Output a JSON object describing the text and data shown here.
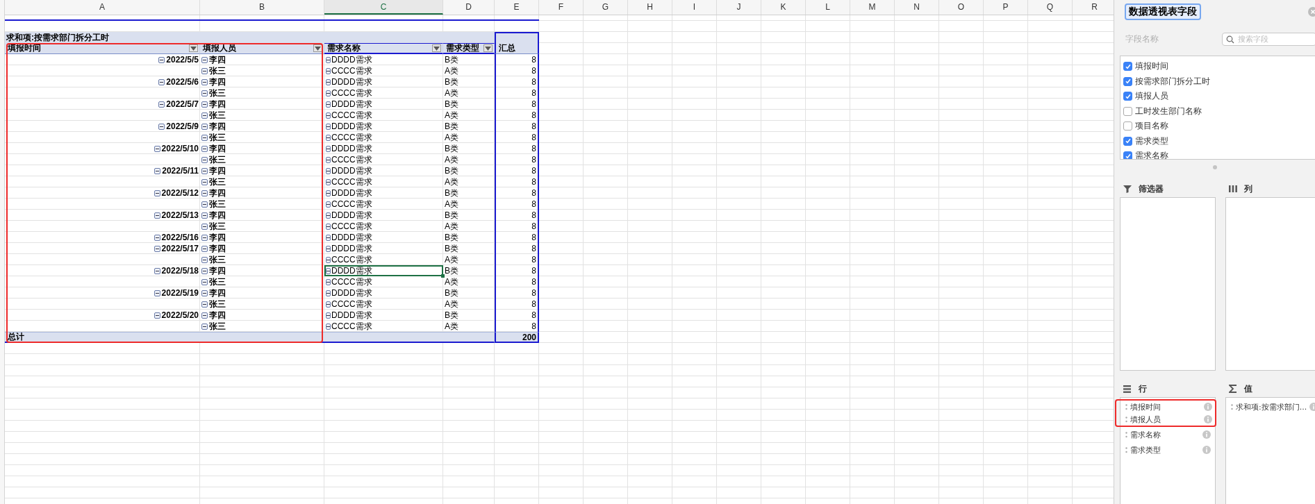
{
  "columns": [
    {
      "label": "A",
      "selected": false
    },
    {
      "label": "B",
      "selected": false
    },
    {
      "label": "C",
      "selected": true
    },
    {
      "label": "D",
      "selected": false
    },
    {
      "label": "E",
      "selected": false
    },
    {
      "label": "F",
      "selected": false
    },
    {
      "label": "G",
      "selected": false
    },
    {
      "label": "H",
      "selected": false
    },
    {
      "label": "I",
      "selected": false
    },
    {
      "label": "J",
      "selected": false
    },
    {
      "label": "K",
      "selected": false
    },
    {
      "label": "L",
      "selected": false
    },
    {
      "label": "M",
      "selected": false
    },
    {
      "label": "N",
      "selected": false
    },
    {
      "label": "O",
      "selected": false
    },
    {
      "label": "P",
      "selected": false
    },
    {
      "label": "Q",
      "selected": false
    },
    {
      "label": "R",
      "selected": false
    }
  ],
  "pivot": {
    "title": "求和项:按需求部门拆分工时",
    "headers": [
      {
        "label": "填报时间",
        "filter": true
      },
      {
        "label": "填报人员",
        "filter": true
      },
      {
        "label": "需求名称",
        "filter": true
      },
      {
        "label": "需求类型",
        "filter": true
      },
      {
        "label": "汇总",
        "filter": false
      }
    ],
    "rows": [
      {
        "date": "2022/5/5",
        "person": "李四",
        "name": "DDDD需求",
        "type": "B类",
        "value": "8",
        "selected": false
      },
      {
        "person": "张三",
        "name": "CCCC需求",
        "type": "A类",
        "value": "8",
        "selected": false
      },
      {
        "date": "2022/5/6",
        "person": "李四",
        "name": "DDDD需求",
        "type": "B类",
        "value": "8",
        "selected": false
      },
      {
        "person": "张三",
        "name": "CCCC需求",
        "type": "A类",
        "value": "8",
        "selected": false
      },
      {
        "date": "2022/5/7",
        "person": "李四",
        "name": "DDDD需求",
        "type": "B类",
        "value": "8",
        "selected": false
      },
      {
        "person": "张三",
        "name": "CCCC需求",
        "type": "A类",
        "value": "8",
        "selected": false
      },
      {
        "date": "2022/5/9",
        "person": "李四",
        "name": "DDDD需求",
        "type": "B类",
        "value": "8",
        "selected": false
      },
      {
        "person": "张三",
        "name": "CCCC需求",
        "type": "A类",
        "value": "8",
        "selected": false
      },
      {
        "date": "2022/5/10",
        "person": "李四",
        "name": "DDDD需求",
        "type": "B类",
        "value": "8",
        "selected": false
      },
      {
        "person": "张三",
        "name": "CCCC需求",
        "type": "A类",
        "value": "8",
        "selected": false
      },
      {
        "date": "2022/5/11",
        "person": "李四",
        "name": "DDDD需求",
        "type": "B类",
        "value": "8",
        "selected": false
      },
      {
        "person": "张三",
        "name": "CCCC需求",
        "type": "A类",
        "value": "8",
        "selected": false
      },
      {
        "date": "2022/5/12",
        "person": "李四",
        "name": "DDDD需求",
        "type": "B类",
        "value": "8",
        "selected": false
      },
      {
        "person": "张三",
        "name": "CCCC需求",
        "type": "A类",
        "value": "8",
        "selected": false
      },
      {
        "date": "2022/5/13",
        "person": "李四",
        "name": "DDDD需求",
        "type": "B类",
        "value": "8",
        "selected": false
      },
      {
        "person": "张三",
        "name": "CCCC需求",
        "type": "A类",
        "value": "8",
        "selected": false
      },
      {
        "date": "2022/5/16",
        "person": "李四",
        "name": "DDDD需求",
        "type": "B类",
        "value": "8",
        "selected": false
      },
      {
        "date": "2022/5/17",
        "person": "李四",
        "name": "DDDD需求",
        "type": "B类",
        "value": "8",
        "selected": false
      },
      {
        "person": "张三",
        "name": "CCCC需求",
        "type": "A类",
        "value": "8",
        "selected": false
      },
      {
        "date": "2022/5/18",
        "person": "李四",
        "name": "DDDD需求",
        "type": "B类",
        "value": "8",
        "selected": true
      },
      {
        "person": "张三",
        "name": "CCCC需求",
        "type": "A类",
        "value": "8",
        "selected": false
      },
      {
        "date": "2022/5/19",
        "person": "李四",
        "name": "DDDD需求",
        "type": "B类",
        "value": "8",
        "selected": false
      },
      {
        "person": "张三",
        "name": "CCCC需求",
        "type": "A类",
        "value": "8",
        "selected": false
      },
      {
        "date": "2022/5/20",
        "person": "李四",
        "name": "DDDD需求",
        "type": "B类",
        "value": "8",
        "selected": false
      },
      {
        "person": "张三",
        "name": "CCCC需求",
        "type": "A类",
        "value": "8",
        "selected": false
      }
    ],
    "total": {
      "label": "总计",
      "value": "200"
    }
  },
  "panel": {
    "title": "数据透视表字段",
    "field_label": "字段名称",
    "search": {
      "placeholder": "搜索字段"
    },
    "fields": [
      {
        "label": "填报时间",
        "checked": true
      },
      {
        "label": "按需求部门拆分工时",
        "checked": true
      },
      {
        "label": "填报人员",
        "checked": true
      },
      {
        "label": "工时发生部门名称",
        "checked": false
      },
      {
        "label": "项目名称",
        "checked": false
      },
      {
        "label": "需求类型",
        "checked": true
      },
      {
        "label": "需求名称",
        "checked": true
      }
    ],
    "areas": [
      {
        "kind": "filter",
        "label": "筛选器"
      },
      {
        "kind": "columns",
        "label": "列"
      },
      {
        "kind": "rows",
        "label": "行",
        "items": [
          {
            "label": "填报时间",
            "highlighted": true
          },
          {
            "label": "填报人员",
            "highlighted": true
          },
          {
            "label": "需求名称",
            "highlighted": false
          },
          {
            "label": "需求类型",
            "highlighted": false
          }
        ]
      },
      {
        "kind": "values",
        "label": "值",
        "items": [
          {
            "label": "求和项:按需求部门...",
            "highlighted": false
          }
        ]
      }
    ]
  }
}
